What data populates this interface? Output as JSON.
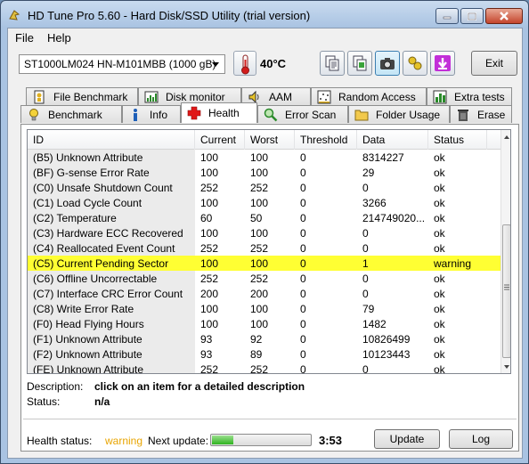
{
  "window": {
    "title": "HD Tune Pro 5.60 - Hard Disk/SSD Utility (trial version)"
  },
  "menu": {
    "file": "File",
    "help": "Help"
  },
  "toolbar": {
    "drive": "ST1000LM024 HN-M101MBB (1000 gB)",
    "temperature": "40°C",
    "exit_label": "Exit"
  },
  "tabs": {
    "row1": [
      {
        "label": "File Benchmark",
        "icon": "file-benchmark-icon"
      },
      {
        "label": "Disk monitor",
        "icon": "disk-monitor-icon"
      },
      {
        "label": "AAM",
        "icon": "speaker-icon"
      },
      {
        "label": "Random Access",
        "icon": "random-access-icon"
      },
      {
        "label": "Extra tests",
        "icon": "extra-tests-icon"
      }
    ],
    "row2": [
      {
        "label": "Benchmark",
        "icon": "lightbulb-icon"
      },
      {
        "label": "Info",
        "icon": "info-icon"
      },
      {
        "label": "Health",
        "icon": "health-cross-icon"
      },
      {
        "label": "Error Scan",
        "icon": "magnifier-icon"
      },
      {
        "label": "Folder Usage",
        "icon": "folder-icon"
      },
      {
        "label": "Erase",
        "icon": "trash-icon"
      }
    ],
    "selected": "Health"
  },
  "table": {
    "columns": [
      "ID",
      "Current",
      "Worst",
      "Threshold",
      "Data",
      "Status"
    ],
    "rows": [
      [
        "(B5) Unknown Attribute",
        "100",
        "100",
        "0",
        "8314227",
        "ok"
      ],
      [
        "(BF) G-sense Error Rate",
        "100",
        "100",
        "0",
        "29",
        "ok"
      ],
      [
        "(C0) Unsafe Shutdown Count",
        "252",
        "252",
        "0",
        "0",
        "ok"
      ],
      [
        "(C1) Load Cycle Count",
        "100",
        "100",
        "0",
        "3266",
        "ok"
      ],
      [
        "(C2) Temperature",
        "60",
        "50",
        "0",
        "214749020...",
        "ok"
      ],
      [
        "(C3) Hardware ECC Recovered",
        "100",
        "100",
        "0",
        "0",
        "ok"
      ],
      [
        "(C4) Reallocated Event Count",
        "252",
        "252",
        "0",
        "0",
        "ok"
      ],
      [
        "(C5) Current Pending Sector",
        "100",
        "100",
        "0",
        "1",
        "warning"
      ],
      [
        "(C6) Offline Uncorrectable",
        "252",
        "252",
        "0",
        "0",
        "ok"
      ],
      [
        "(C7) Interface CRC Error Count",
        "200",
        "200",
        "0",
        "0",
        "ok"
      ],
      [
        "(C8) Write Error Rate",
        "100",
        "100",
        "0",
        "79",
        "ok"
      ],
      [
        "(F0) Head Flying Hours",
        "100",
        "100",
        "0",
        "1482",
        "ok"
      ],
      [
        "(F1) Unknown Attribute",
        "93",
        "92",
        "0",
        "10826499",
        "ok"
      ],
      [
        "(F2) Unknown Attribute",
        "93",
        "89",
        "0",
        "10123443",
        "ok"
      ],
      [
        "(FE) Unknown Attribute",
        "252",
        "252",
        "0",
        "0",
        "ok"
      ]
    ],
    "highlighted_row": 7
  },
  "details": {
    "description_label": "Description:",
    "description_value": "click on an item for a detailed description",
    "status_label": "Status:",
    "status_value": "n/a"
  },
  "footer": {
    "health_label": "Health status:",
    "health_value": "warning",
    "next_update_label": "Next update:",
    "progress_fraction": 0.22,
    "timer": "3:53",
    "update_label": "Update",
    "log_label": "Log"
  },
  "colors": {
    "warning_row": "#ffff33",
    "warning_text": "#e8a400",
    "progress_fill": "#2fb31f"
  }
}
